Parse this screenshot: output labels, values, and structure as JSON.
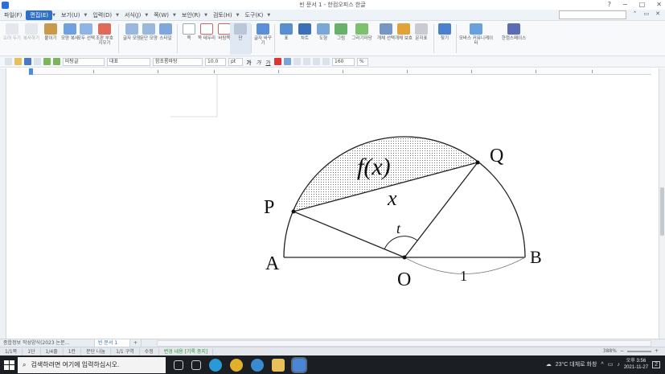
{
  "window": {
    "title": "빈 문서 1 - 한컴오피스 한글"
  },
  "menu": [
    {
      "label": "파일(F)",
      "active": false
    },
    {
      "label": "편집(E)",
      "active": true
    },
    {
      "label": "보기(U)",
      "active": false
    },
    {
      "label": "입력(D)",
      "active": false
    },
    {
      "label": "서식(J)",
      "active": false
    },
    {
      "label": "쪽(W)",
      "active": false
    },
    {
      "label": "보안(R)",
      "active": false
    },
    {
      "label": "검토(H)",
      "active": false
    },
    {
      "label": "도구(K)",
      "active": false
    }
  ],
  "ribbon": [
    {
      "label": "오려 두기",
      "icon": "scissors-icon",
      "dim": true
    },
    {
      "label": "복사하기",
      "icon": "copy-icon",
      "dim": true
    },
    {
      "label": "붙이기",
      "icon": "paste-icon",
      "dim": false
    },
    {
      "label": "모양 복사",
      "icon": "format-painter-icon",
      "dim": false
    },
    {
      "label": "모두 선택",
      "icon": "select-all-icon",
      "dim": false
    },
    {
      "label": "조판 부호 지우기",
      "icon": "clear-code-icon",
      "dim": false
    },
    {
      "label": "글자 모양",
      "icon": "char-shape-icon",
      "dim": false
    },
    {
      "label": "문단 모양",
      "icon": "para-shape-icon",
      "dim": false
    },
    {
      "label": "스타일",
      "icon": "style-icon",
      "dim": false
    },
    {
      "label": "쪽",
      "icon": "page-icon",
      "dim": false
    },
    {
      "label": "쪽 테두리",
      "icon": "page-border-icon",
      "dim": false
    },
    {
      "label": "바탕쪽",
      "icon": "master-page-icon",
      "dim": false
    },
    {
      "label": "단",
      "icon": "column-icon",
      "dim": false
    },
    {
      "label": "글자 바꾸기",
      "icon": "replace-icon",
      "dim": false
    },
    {
      "label": "표",
      "icon": "table-icon",
      "dim": false
    },
    {
      "label": "차트",
      "icon": "chart-icon",
      "dim": false
    },
    {
      "label": "도형",
      "icon": "shape-icon",
      "dim": false
    },
    {
      "label": "그림",
      "icon": "picture-icon",
      "dim": false
    },
    {
      "label": "그리기마당",
      "icon": "clipart-icon",
      "dim": false
    },
    {
      "label": "개체 선택",
      "icon": "object-select-icon",
      "dim": false
    },
    {
      "label": "개체 보호",
      "icon": "object-lock-icon",
      "dim": false
    },
    {
      "label": "문자표",
      "icon": "symbol-icon",
      "dim": false
    },
    {
      "label": "찾기",
      "icon": "find-icon",
      "dim": false
    },
    {
      "label": "모바스 커뮤니케이터",
      "icon": "messenger-icon",
      "dim": false
    },
    {
      "label": "한컴스페이스",
      "icon": "cloud-icon",
      "dim": false
    }
  ],
  "formatbar": {
    "style": "바탕글",
    "lang": "대표",
    "font": "함초롬바탕",
    "size": "10.0",
    "unit": "pt",
    "bold": "가",
    "italic": "가",
    "underline": "가",
    "linespacing": "160",
    "percent": "%"
  },
  "figure": {
    "labels": {
      "P": "P",
      "Q": "Q",
      "A": "A",
      "B": "B",
      "O": "O",
      "t": "t",
      "fx": "f(x)",
      "x": "x",
      "one": "1"
    }
  },
  "tabs": [
    {
      "label": "종합정보 작성양식(2023 논문...",
      "active": false
    },
    {
      "label": "빈 문서 1",
      "active": true
    },
    {
      "label": "+",
      "active": false
    }
  ],
  "status": [
    {
      "label": "1/1쪽"
    },
    {
      "label": "1단"
    },
    {
      "label": "1/4줄"
    },
    {
      "label": "1칸"
    },
    {
      "label": "문단 나눔"
    },
    {
      "label": "1/1 구역"
    },
    {
      "label": "수정"
    },
    {
      "label": "변경 내용 [기록 중지]",
      "green": true
    }
  ],
  "zoom": "388%",
  "taskbar": {
    "search_placeholder": "검색하려면 여기에 입력하십시오.",
    "weather": "23°C 대체로 화창",
    "time": "오후 3:56",
    "date": "2021-11-27",
    "notification_count": "2"
  }
}
